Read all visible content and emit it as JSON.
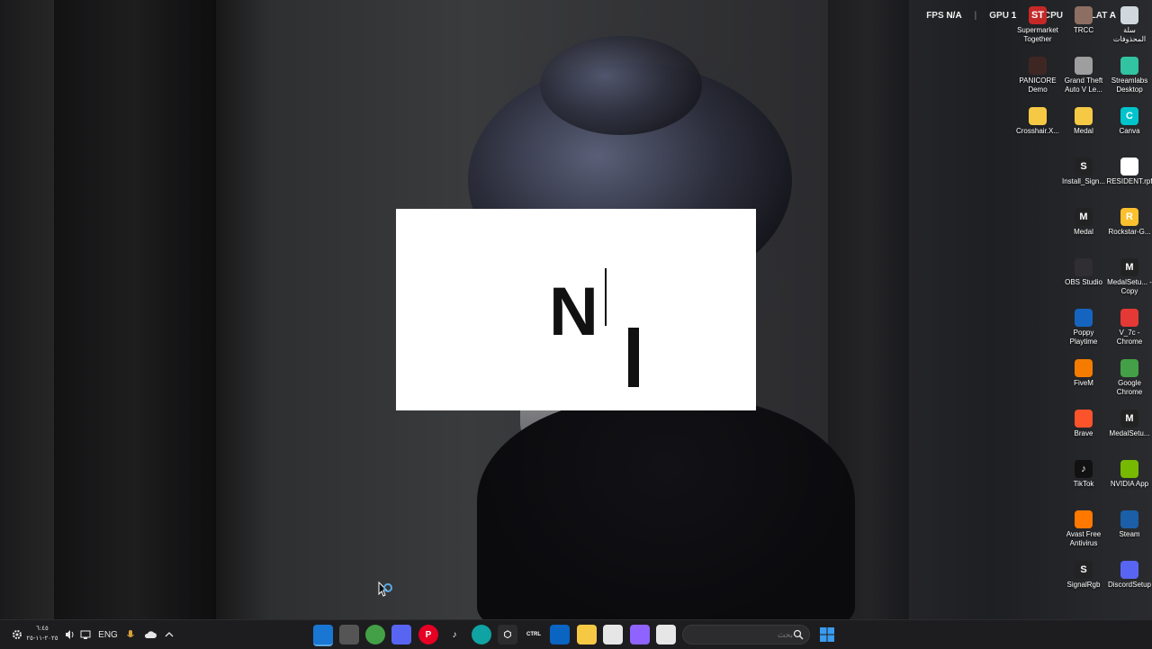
{
  "hud": {
    "fps_label": "FPS",
    "fps_value": "N/A",
    "gpu_label": "GPU",
    "gpu_value": "1",
    "cpu_label": "CPU",
    "cpu_value": "",
    "lat_label": "LAT",
    "lat_value": "A"
  },
  "splash": {
    "logo_text": "N"
  },
  "desktop_icons": [
    {
      "label": "Supermarket Together",
      "icon": "supermarket-icon",
      "color": "#c62828",
      "glyph": "ST"
    },
    {
      "label": "TRCC",
      "icon": "trcc-icon",
      "color": "#8d6e63",
      "glyph": ""
    },
    {
      "label": "سلة المحذوفات",
      "icon": "recycle-bin-icon",
      "color": "#cfd8dc",
      "glyph": ""
    },
    {
      "label": "PANICORE Demo",
      "icon": "panicore-icon",
      "color": "#3e2723",
      "glyph": ""
    },
    {
      "label": "Grand Theft Auto V Le...",
      "icon": "gta-icon",
      "color": "#9e9e9e",
      "glyph": ""
    },
    {
      "label": "Streamlabs Desktop",
      "icon": "streamlabs-icon",
      "color": "#31c3a2",
      "glyph": ""
    },
    {
      "label": "Crosshair.X...",
      "icon": "folder-icon",
      "color": "#f6c945",
      "glyph": ""
    },
    {
      "label": "Medal",
      "icon": "folder-icon",
      "color": "#f6c945",
      "glyph": ""
    },
    {
      "label": "Canva",
      "icon": "canva-icon",
      "color": "#00c4cc",
      "glyph": "C"
    },
    {
      "label": "Install_Sign...",
      "icon": "signalrgb-icon",
      "color": "#222222",
      "glyph": "S"
    },
    {
      "label": "RESIDENT.rpf",
      "icon": "file-icon",
      "color": "#ffffff",
      "glyph": ""
    },
    {
      "label": "Medal",
      "icon": "medal-icon",
      "color": "#222222",
      "glyph": "M"
    },
    {
      "label": "Rockstar-G...",
      "icon": "rockstar-icon",
      "color": "#fbc02d",
      "glyph": "R"
    },
    {
      "label": "OBS Studio",
      "icon": "obs-icon",
      "color": "#302e31",
      "glyph": ""
    },
    {
      "label": "MedalSetu... - Copy",
      "icon": "medal-icon",
      "color": "#222222",
      "glyph": "M"
    },
    {
      "label": "Poppy Playtime",
      "icon": "poppy-icon",
      "color": "#1565c0",
      "glyph": ""
    },
    {
      "label": "V_7c - Chrome",
      "icon": "chrome-icon",
      "color": "#e53935",
      "glyph": ""
    },
    {
      "label": "FiveM",
      "icon": "fivem-icon",
      "color": "#f57c00",
      "glyph": ""
    },
    {
      "label": "Google Chrome",
      "icon": "chrome-icon",
      "color": "#43a047",
      "glyph": ""
    },
    {
      "label": "Brave",
      "icon": "brave-icon",
      "color": "#fb542b",
      "glyph": ""
    },
    {
      "label": "MedalSetu...",
      "icon": "medal-icon",
      "color": "#222222",
      "glyph": "M"
    },
    {
      "label": "TikTok",
      "icon": "tiktok-icon",
      "color": "#111111",
      "glyph": "♪"
    },
    {
      "label": "NVIDIA App",
      "icon": "nvidia-icon",
      "color": "#76b900",
      "glyph": ""
    },
    {
      "label": "Avast Free Antivirus",
      "icon": "avast-icon",
      "color": "#ff7800",
      "glyph": ""
    },
    {
      "label": "Steam",
      "icon": "steam-icon",
      "color": "#1b5fa8",
      "glyph": ""
    },
    {
      "label": "SignalRgb",
      "icon": "signalrgb-icon",
      "color": "#222222",
      "glyph": "S"
    },
    {
      "label": "DiscordSetup",
      "icon": "discord-icon",
      "color": "#5865f2",
      "glyph": ""
    }
  ],
  "taskbar": {
    "clock_time": "٦:٤٥",
    "clock_date": "٢٠٢٥-١١-٢٥",
    "lang": "ENG",
    "search_placeholder": "بحث",
    "apps": [
      {
        "name": "notes-app-icon",
        "color": "#1976d2",
        "glyph": ""
      },
      {
        "name": "widget-app-icon",
        "color": "#555555",
        "glyph": ""
      },
      {
        "name": "google-chrome-taskbar-icon",
        "color": "#43a047",
        "glyph": ""
      },
      {
        "name": "discord-taskbar-icon",
        "color": "#5865f2",
        "glyph": ""
      },
      {
        "name": "pinterest-taskbar-icon",
        "color": "#e60023",
        "glyph": "P"
      },
      {
        "name": "tiktok-taskbar-icon",
        "color": "#1d1d1f",
        "glyph": "♪"
      },
      {
        "name": "edge-taskbar-icon",
        "color": "#0fa3a3",
        "glyph": ""
      },
      {
        "name": "app-taskbar-icon",
        "color": "#2c2c2e",
        "glyph": "⬡"
      },
      {
        "name": "ctrl-taskbar-icon",
        "color": "#1d1d1f",
        "glyph": "CTRL"
      },
      {
        "name": "outlook-taskbar-icon",
        "color": "#0a64c2",
        "glyph": ""
      },
      {
        "name": "file-explorer-taskbar-icon",
        "color": "#f6c945",
        "glyph": ""
      },
      {
        "name": "store-taskbar-icon",
        "color": "#e6e6e6",
        "glyph": ""
      },
      {
        "name": "copilot-taskbar-icon",
        "color": "#8e63ff",
        "glyph": ""
      },
      {
        "name": "terminal-taskbar-icon",
        "color": "#e6e6e6",
        "glyph": ""
      }
    ]
  }
}
